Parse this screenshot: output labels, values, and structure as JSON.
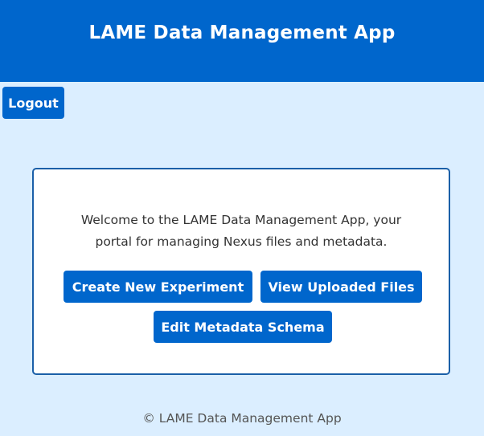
{
  "header": {
    "title": "LAME Data Management App"
  },
  "nav": {
    "logout_label": "Logout"
  },
  "main": {
    "welcome_line1": "Welcome to the LAME Data Management App, your",
    "welcome_line2": "portal for managing Nexus files and metadata.",
    "buttons": {
      "create_experiment": "Create New Experiment",
      "view_files": "View Uploaded Files",
      "edit_schema": "Edit Metadata Schema"
    }
  },
  "footer": {
    "text": "© LAME Data Management App"
  },
  "colors": {
    "primary": "#0066cc",
    "background": "#dbeeff",
    "card_border": "#1a5fa8"
  }
}
